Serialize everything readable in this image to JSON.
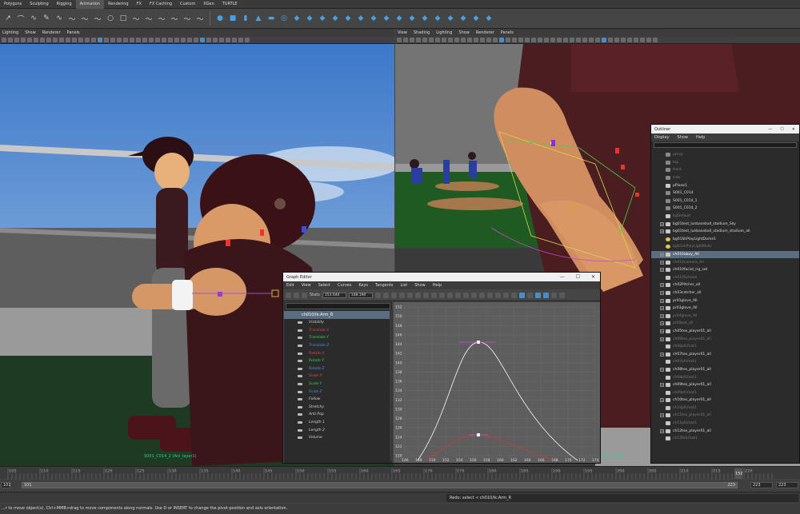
{
  "shelf_tabs": [
    "Polygons",
    "Sculpting",
    "Rigging",
    "Animation",
    "Rendering",
    "FX",
    "FX Caching",
    "Custom",
    "XGen",
    "TURTLE"
  ],
  "shelf_icons": [
    "curve-tool-icon",
    "arc-tool-icon",
    "ep-curve-icon",
    "pencil-curve-icon",
    "bezier-icon",
    "curve-icon",
    "curve-icon",
    "curve-icon",
    "circle-icon",
    "square-icon",
    "curve-icon",
    "curve-icon",
    "curve-icon",
    "curve-icon",
    "curve-icon",
    "curve-icon",
    "sphere-icon",
    "cube-icon",
    "cylinder-icon",
    "cone-icon",
    "plane-icon",
    "torus-icon",
    "poly-icon",
    "poly-icon",
    "poly-icon",
    "poly-icon",
    "poly-icon",
    "poly-icon",
    "poly-icon",
    "poly-icon",
    "poly-icon",
    "poly-icon",
    "poly-icon",
    "poly-icon",
    "poly-icon",
    "poly-icon",
    "poly-icon",
    "poly-icon"
  ],
  "viewport_left": {
    "menu": [
      "Lighting",
      "Show",
      "Renderer",
      "Panels"
    ],
    "hud_label": "S001_C014_2 (Ani_layer1)"
  },
  "viewport_right": {
    "menu": [
      "View",
      "Shading",
      "Lighting",
      "Show",
      "Renderer",
      "Panels"
    ],
    "hud_label": "(Ani_layer1)"
  },
  "outliner": {
    "title": "Outliner",
    "menu": [
      "Display",
      "Show",
      "Help"
    ],
    "items": [
      {
        "label": "persp",
        "dim": true,
        "type": "cam",
        "plus": false
      },
      {
        "label": "top",
        "dim": true,
        "type": "cam",
        "plus": false
      },
      {
        "label": "front",
        "dim": true,
        "type": "cam",
        "plus": false
      },
      {
        "label": "side",
        "dim": true,
        "type": "cam",
        "plus": false
      },
      {
        "label": "pPlane1",
        "dim": false,
        "type": "obj",
        "plus": false
      },
      {
        "label": "S001_C014",
        "dim": false,
        "type": "cam",
        "plus": false
      },
      {
        "label": "S001_C014_1",
        "dim": false,
        "type": "cam",
        "plus": false
      },
      {
        "label": "S001_C014_2",
        "dim": false,
        "type": "cam",
        "plus": false
      },
      {
        "label": "bgDefault",
        "dim": true,
        "type": "obj",
        "plus": false
      },
      {
        "label": "bg01test_lunbaseball_stadium_Sky",
        "dim": false,
        "type": "obj",
        "plus": true
      },
      {
        "label": "bg01test_lunbaseball_stadium_stadium_all",
        "dim": false,
        "type": "obj",
        "plus": true
      },
      {
        "label": "bg01ShPlayLightDome1",
        "dim": false,
        "type": "lt",
        "plus": false
      },
      {
        "label": "bg01shPlayLightMulti",
        "dim": true,
        "type": "lt",
        "plus": false
      },
      {
        "label": "ch010aboy_All",
        "dim": false,
        "type": "obj",
        "plus": true,
        "sel": true
      },
      {
        "label": "ch010camera_All",
        "dim": true,
        "type": "obj",
        "plus": true
      },
      {
        "label": "ch010facial_rig_set",
        "dim": false,
        "type": "obj",
        "plus": true
      },
      {
        "label": "ch010Scheen",
        "dim": true,
        "type": "obj",
        "plus": false
      },
      {
        "label": "ch02Pitcher_all",
        "dim": false,
        "type": "obj",
        "plus": true
      },
      {
        "label": "ch03catcher_all",
        "dim": false,
        "type": "obj",
        "plus": true
      },
      {
        "label": "pr01glove_All",
        "dim": false,
        "type": "obj",
        "plus": true
      },
      {
        "label": "pr03glove_All",
        "dim": false,
        "type": "obj",
        "plus": true
      },
      {
        "label": "pr04glove_All",
        "dim": true,
        "type": "obj",
        "plus": true
      },
      {
        "label": "pr05bat_all",
        "dim": true,
        "type": "obj",
        "plus": true
      },
      {
        "label": "ch05tex_player01_all",
        "dim": false,
        "type": "obj",
        "plus": true
      },
      {
        "label": "ch06tex_player01_all",
        "dim": true,
        "type": "obj",
        "plus": true
      },
      {
        "label": "ch06pfLfoot1",
        "dim": true,
        "type": "obj",
        "plus": false
      },
      {
        "label": "ch07tex_player01_all",
        "dim": false,
        "type": "obj",
        "plus": true
      },
      {
        "label": "ch07pfLfoot1",
        "dim": true,
        "type": "obj",
        "plus": false
      },
      {
        "label": "ch08tex_player01_all",
        "dim": false,
        "type": "obj",
        "plus": true
      },
      {
        "label": "ch08pfLfoot1",
        "dim": true,
        "type": "obj",
        "plus": false
      },
      {
        "label": "ch09tex_player01_all",
        "dim": false,
        "type": "obj",
        "plus": true
      },
      {
        "label": "ch09pfLfoot1",
        "dim": true,
        "type": "obj",
        "plus": false
      },
      {
        "label": "ch10tex_player01_all",
        "dim": false,
        "type": "obj",
        "plus": true
      },
      {
        "label": "ch10pfLfoot1",
        "dim": true,
        "type": "obj",
        "plus": false
      },
      {
        "label": "ch11tex_player01_all",
        "dim": true,
        "type": "obj",
        "plus": true
      },
      {
        "label": "ch11pfLfoot1",
        "dim": true,
        "type": "obj",
        "plus": false
      },
      {
        "label": "ch12tex_player01_all",
        "dim": false,
        "type": "obj",
        "plus": true
      },
      {
        "label": "ch12ReLfoot1",
        "dim": true,
        "type": "obj",
        "plus": false
      }
    ]
  },
  "graph_editor": {
    "title": "Graph Editor",
    "menu": [
      "Edit",
      "View",
      "Select",
      "Curves",
      "Keys",
      "Tangents",
      "List",
      "Show",
      "Help"
    ],
    "stats_label": "Stats",
    "stats_value_1": "153.044",
    "stats_value_2": "148.190",
    "node": "ch010/ik:Arm_R",
    "attributes": [
      {
        "label": "Visibility",
        "color": "#d0d0d0"
      },
      {
        "label": "Translate X",
        "color": "#e04848"
      },
      {
        "label": "Translate Y",
        "color": "#3ccf5a"
      },
      {
        "label": "Translate Z",
        "color": "#4a8fe0"
      },
      {
        "label": "Rotate X",
        "color": "#e04848"
      },
      {
        "label": "Rotate Y",
        "color": "#3ccf5a"
      },
      {
        "label": "Rotate Z",
        "color": "#4a8fe0"
      },
      {
        "label": "Scale X",
        "color": "#e04848"
      },
      {
        "label": "Scale Y",
        "color": "#3ccf5a"
      },
      {
        "label": "Scale Z",
        "color": "#4a8fe0"
      },
      {
        "label": "Follow",
        "color": "#d0d0d0"
      },
      {
        "label": "Stretchy",
        "color": "#d0d0d0"
      },
      {
        "label": "Anti Pop",
        "color": "#d0d0d0"
      },
      {
        "label": "Length 1",
        "color": "#d0d0d0"
      },
      {
        "label": "Length 2",
        "color": "#d0d0d0"
      },
      {
        "label": "Volume",
        "color": "#d0d0d0"
      }
    ],
    "y_ticks": [
      "152",
      "150",
      "148",
      "146",
      "144",
      "142",
      "140",
      "138",
      "136",
      "134",
      "132",
      "130",
      "128",
      "126",
      "124",
      "122",
      "120"
    ],
    "x_ticks": [
      "146",
      "148",
      "150",
      "152",
      "154",
      "156",
      "158",
      "160",
      "162",
      "164",
      "166",
      "168",
      "170",
      "172",
      "174"
    ]
  },
  "timeline": {
    "ticks": [
      "105",
      "110",
      "115",
      "120",
      "125",
      "130",
      "135",
      "140",
      "145",
      "150",
      "155",
      "160",
      "165",
      "170",
      "175",
      "180",
      "185",
      "190",
      "195",
      "200",
      "205",
      "210",
      "215",
      "220"
    ],
    "current_frame": "152"
  },
  "range": {
    "start_outer": "101",
    "start_inner": "101",
    "end_inner": "223",
    "end_outer": "223",
    "end_field": "223"
  },
  "command_result": "Redo: select -r ch010/ik:Arm_R",
  "help_line": "...r to move object(s). Ctrl+MMB+drag to move components along normals. Use D or INSERT to change the pivot position and axis orientation."
}
